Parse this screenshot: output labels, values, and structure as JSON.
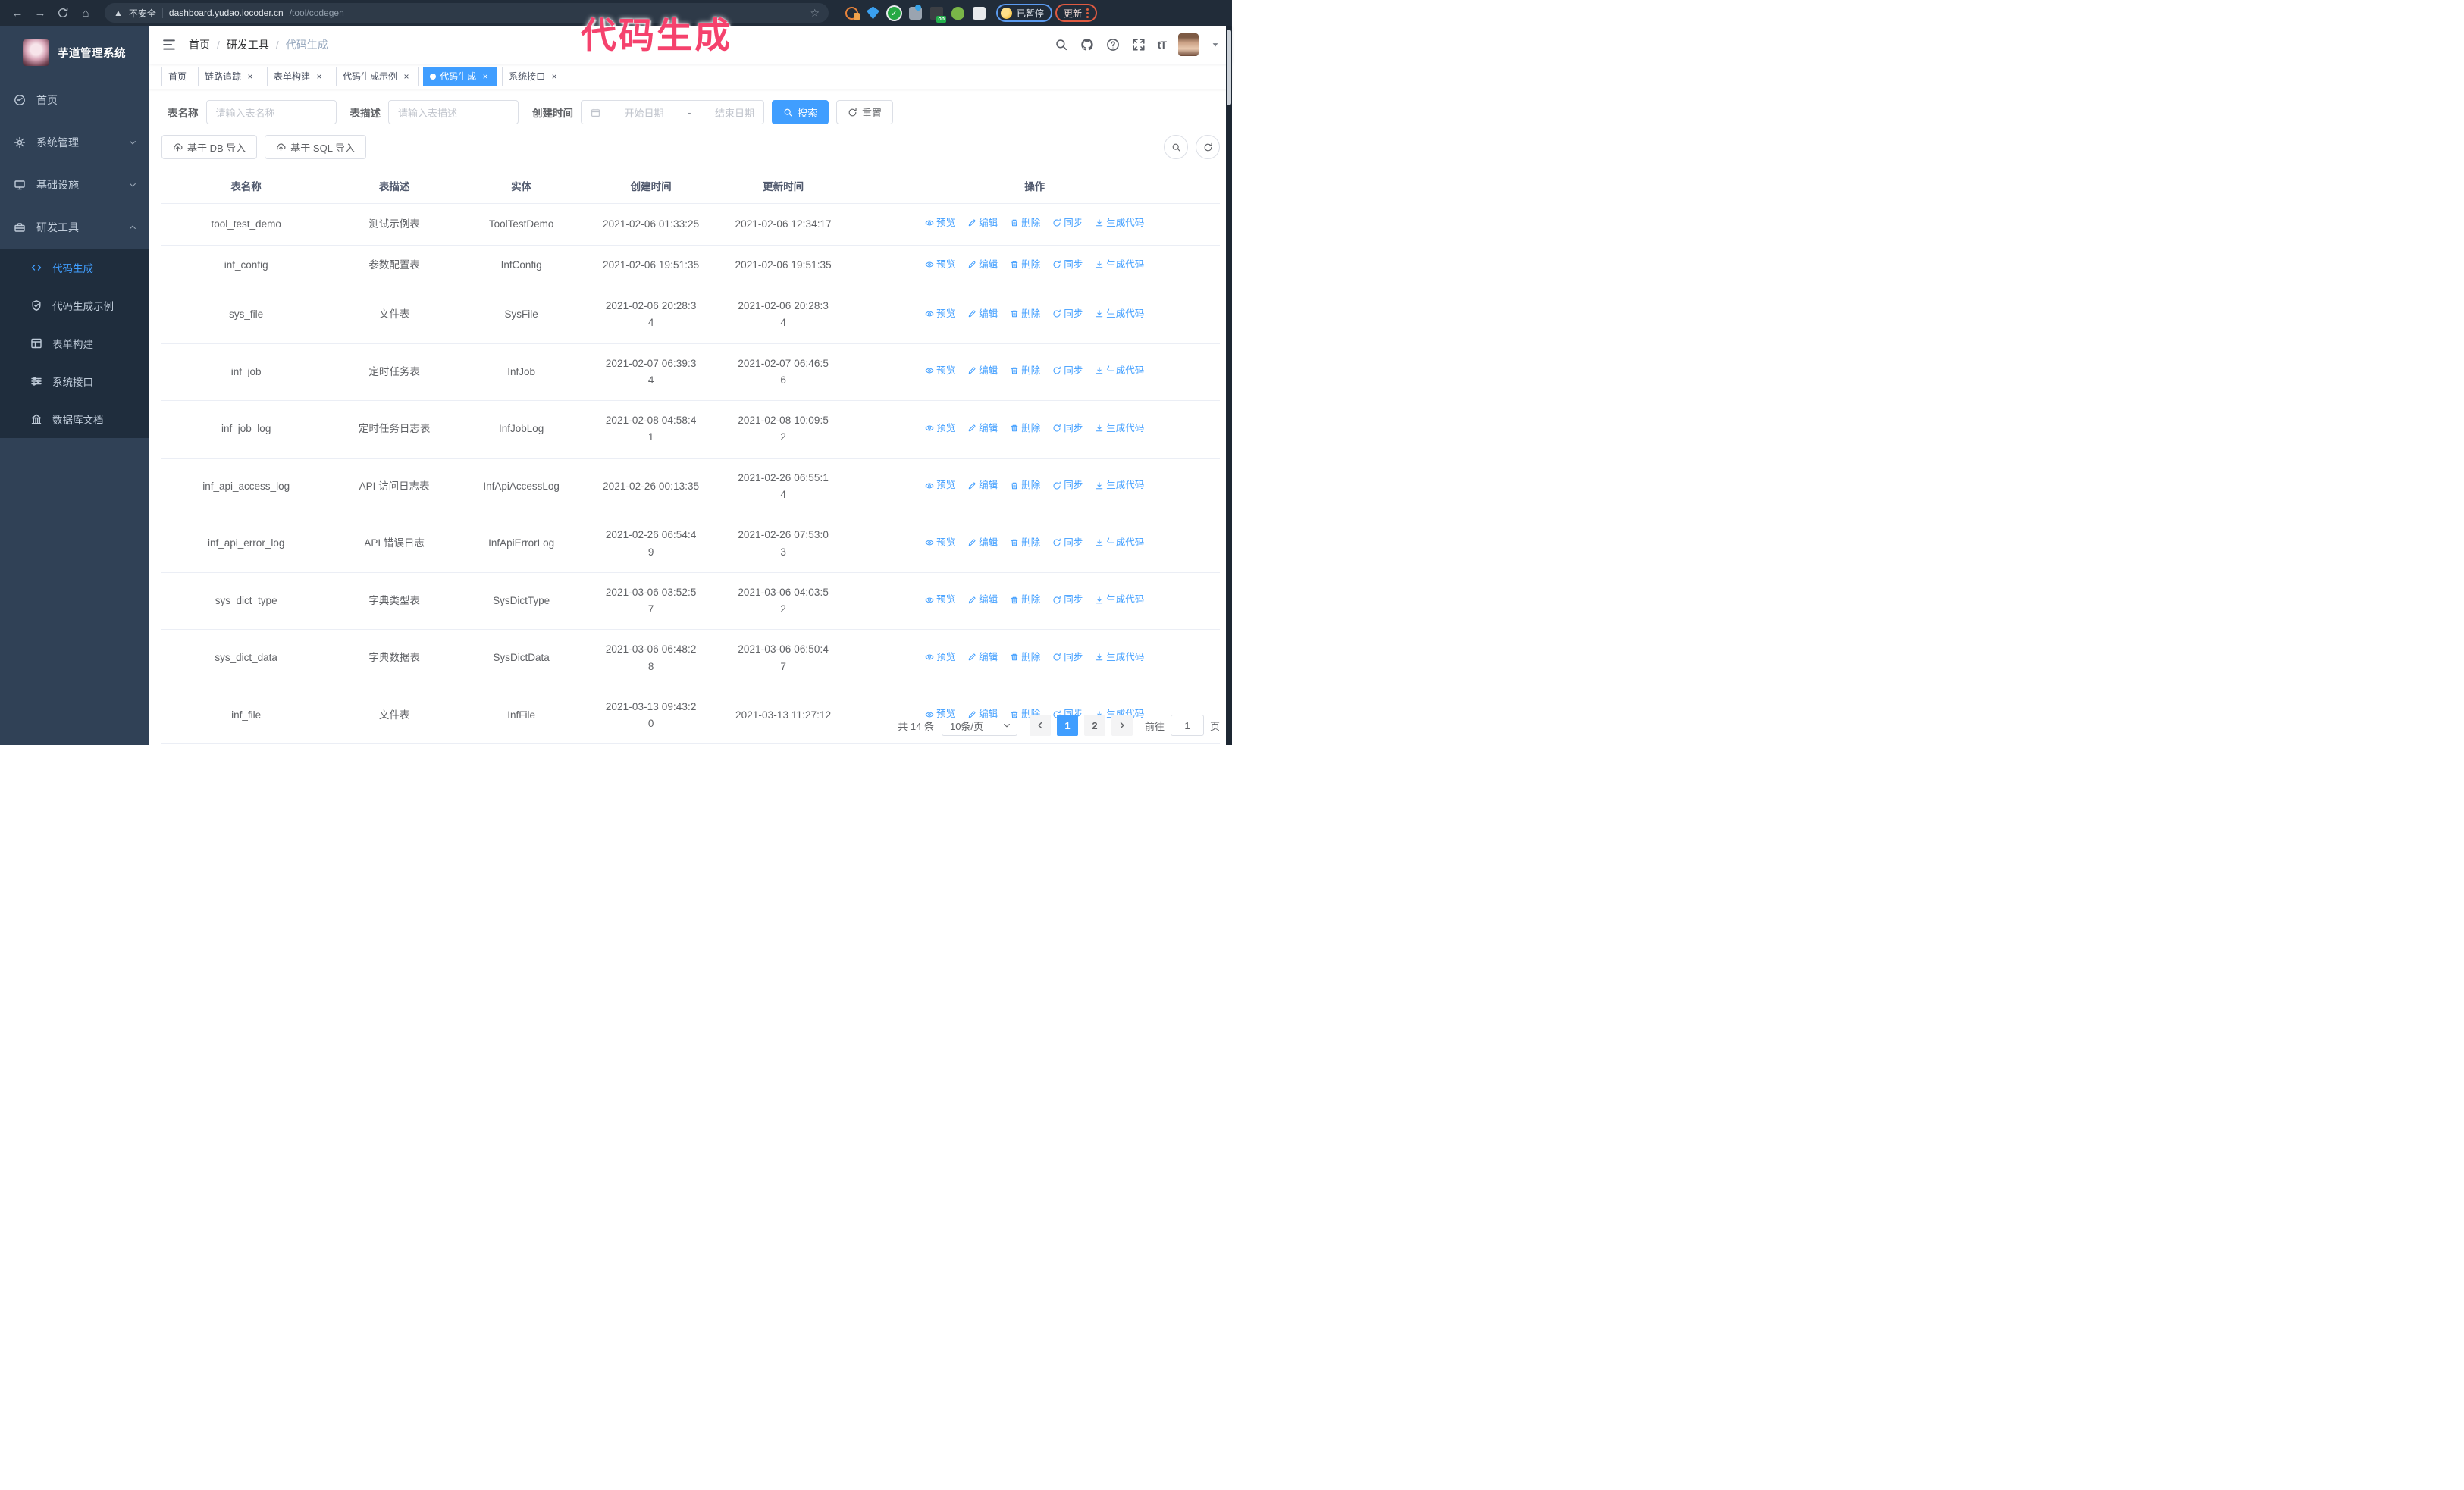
{
  "browser": {
    "security_label": "不安全",
    "url_host": "dashboard.yudao.iocoder.cn",
    "url_path": "/tool/codegen",
    "paused_label": "已暂停",
    "update_label": "更新",
    "extension_on_badge": "on",
    "extension_icons": [
      "orange-ring-extension-icon",
      "blue-gem-extension-icon",
      "green-check-extension-icon",
      "gray-grid-extension-icon",
      "dark-on-extension-icon",
      "green-round-extension-icon",
      "puzzle-extension-icon"
    ]
  },
  "overlay_title": "代码生成",
  "sidebar": {
    "logo_title": "芋道管理系统",
    "items": [
      {
        "key": "home",
        "label": "首页",
        "icon": "dashboard-icon",
        "chevron": null,
        "active": false
      },
      {
        "key": "system-management",
        "label": "系统管理",
        "icon": "gear-icon",
        "chevron": "down",
        "active": false
      },
      {
        "key": "infrastructure",
        "label": "基础设施",
        "icon": "monitor-icon",
        "chevron": "down",
        "active": false
      },
      {
        "key": "dev-tools",
        "label": "研发工具",
        "icon": "toolbox-icon",
        "chevron": "up",
        "active": false
      }
    ],
    "subitems": [
      {
        "key": "codegen",
        "label": "代码生成",
        "icon": "code-icon",
        "active": true
      },
      {
        "key": "codegen-example",
        "label": "代码生成示例",
        "icon": "shield-check-icon",
        "active": false
      },
      {
        "key": "form-builder",
        "label": "表单构建",
        "icon": "form-icon",
        "active": false
      },
      {
        "key": "system-api",
        "label": "系统接口",
        "icon": "sliders-icon",
        "active": false
      },
      {
        "key": "db-doc",
        "label": "数据库文档",
        "icon": "database-icon",
        "active": false
      }
    ]
  },
  "header": {
    "breadcrumb": [
      "首页",
      "研发工具",
      "代码生成"
    ],
    "breadcrumb_separator": "/",
    "text_size_label": "tT"
  },
  "tabs": [
    {
      "key": "home",
      "label": "首页",
      "closable": false,
      "active": false
    },
    {
      "key": "tracing",
      "label": "链路追踪",
      "closable": true,
      "active": false
    },
    {
      "key": "form-builder",
      "label": "表单构建",
      "closable": true,
      "active": false
    },
    {
      "key": "codegen-example",
      "label": "代码生成示例",
      "closable": true,
      "active": false
    },
    {
      "key": "codegen",
      "label": "代码生成",
      "closable": true,
      "active": true
    },
    {
      "key": "system-api",
      "label": "系统接口",
      "closable": true,
      "active": false
    }
  ],
  "filters": {
    "name_label": "表名称",
    "name_placeholder": "请输入表名称",
    "desc_label": "表描述",
    "desc_placeholder": "请输入表描述",
    "time_label": "创建时间",
    "start_placeholder": "开始日期",
    "range_separator": "-",
    "end_placeholder": "结束日期",
    "search_label": "搜索",
    "reset_label": "重置"
  },
  "toolbar": {
    "db_import_label": "基于 DB 导入",
    "sql_import_label": "基于 SQL 导入"
  },
  "table": {
    "headers": [
      "表名称",
      "表描述",
      "实体",
      "创建时间",
      "更新时间",
      "操作"
    ],
    "actions": [
      {
        "label": "预览",
        "icon": "eye-icon"
      },
      {
        "label": "编辑",
        "icon": "edit-icon"
      },
      {
        "label": "删除",
        "icon": "delete-icon"
      },
      {
        "label": "同步",
        "icon": "sync-icon"
      },
      {
        "label": "生成代码",
        "icon": "download-icon"
      }
    ],
    "rows": [
      {
        "name": "tool_test_demo",
        "desc": "测试示例表",
        "entity": "ToolTestDemo",
        "created": "2021-02-06 01:33:25",
        "updated": "2021-02-06 12:34:17"
      },
      {
        "name": "inf_config",
        "desc": "参数配置表",
        "entity": "InfConfig",
        "created": "2021-02-06 19:51:35",
        "updated": "2021-02-06 19:51:35"
      },
      {
        "name": "sys_file",
        "desc": "文件表",
        "entity": "SysFile",
        "created": [
          "2021-02-06 20:28:3",
          "4"
        ],
        "updated": [
          "2021-02-06 20:28:3",
          "4"
        ]
      },
      {
        "name": "inf_job",
        "desc": "定时任务表",
        "entity": "InfJob",
        "created": [
          "2021-02-07 06:39:3",
          "4"
        ],
        "updated": [
          "2021-02-07 06:46:5",
          "6"
        ]
      },
      {
        "name": "inf_job_log",
        "desc": "定时任务日志表",
        "entity": "InfJobLog",
        "created": [
          "2021-02-08 04:58:4",
          "1"
        ],
        "updated": [
          "2021-02-08 10:09:5",
          "2"
        ]
      },
      {
        "name": "inf_api_access_log",
        "desc": "API 访问日志表",
        "entity": "InfApiAccessLog",
        "created": "2021-02-26 00:13:35",
        "updated": [
          "2021-02-26 06:55:1",
          "4"
        ]
      },
      {
        "name": "inf_api_error_log",
        "desc": "API 错误日志",
        "entity": "InfApiErrorLog",
        "created": [
          "2021-02-26 06:54:4",
          "9"
        ],
        "updated": [
          "2021-02-26 07:53:0",
          "3"
        ]
      },
      {
        "name": "sys_dict_type",
        "desc": "字典类型表",
        "entity": "SysDictType",
        "created": [
          "2021-03-06 03:52:5",
          "7"
        ],
        "updated": [
          "2021-03-06 04:03:5",
          "2"
        ]
      },
      {
        "name": "sys_dict_data",
        "desc": "字典数据表",
        "entity": "SysDictData",
        "created": [
          "2021-03-06 06:48:2",
          "8"
        ],
        "updated": [
          "2021-03-06 06:50:4",
          "7"
        ]
      },
      {
        "name": "inf_file",
        "desc": "文件表",
        "entity": "InfFile",
        "created": [
          "2021-03-13 09:43:2",
          "0"
        ],
        "updated": "2021-03-13 11:27:12"
      }
    ]
  },
  "pagination": {
    "total": "共 14 条",
    "page_size": "10条/页",
    "pages": [
      "1",
      "2"
    ],
    "active_page": "1",
    "goto_label": "前往",
    "goto_value": "1",
    "unit_label": "页"
  }
}
